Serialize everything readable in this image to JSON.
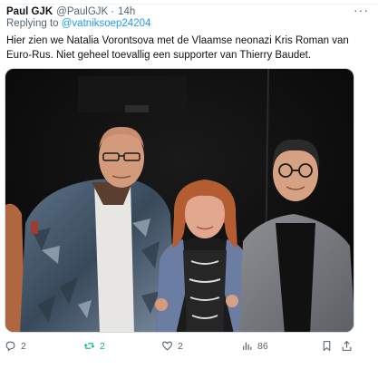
{
  "tweet": {
    "author_name": "Paul GJK",
    "author_handle": "@PaulGJK",
    "separator": "·",
    "time": "14h",
    "reply_prefix": "Replying to",
    "reply_to": "@vatniksoep24204",
    "text": "Hier zien we Natalia Vorontsova met de Vlaamse neonazi Kris Roman van Euro-Rus. Niet geheel toevallig een supporter van Thierry Baudet."
  },
  "actions": {
    "replies": "2",
    "retweets": "2",
    "likes": "2",
    "views": "86"
  },
  "colors": {
    "accent": "#1d9bf0",
    "retweet_active": "#00ba7c",
    "muted": "#536471"
  },
  "icons": [
    "more-icon",
    "reply-icon",
    "retweet-icon",
    "like-icon",
    "views-icon",
    "bookmark-icon",
    "share-icon"
  ]
}
